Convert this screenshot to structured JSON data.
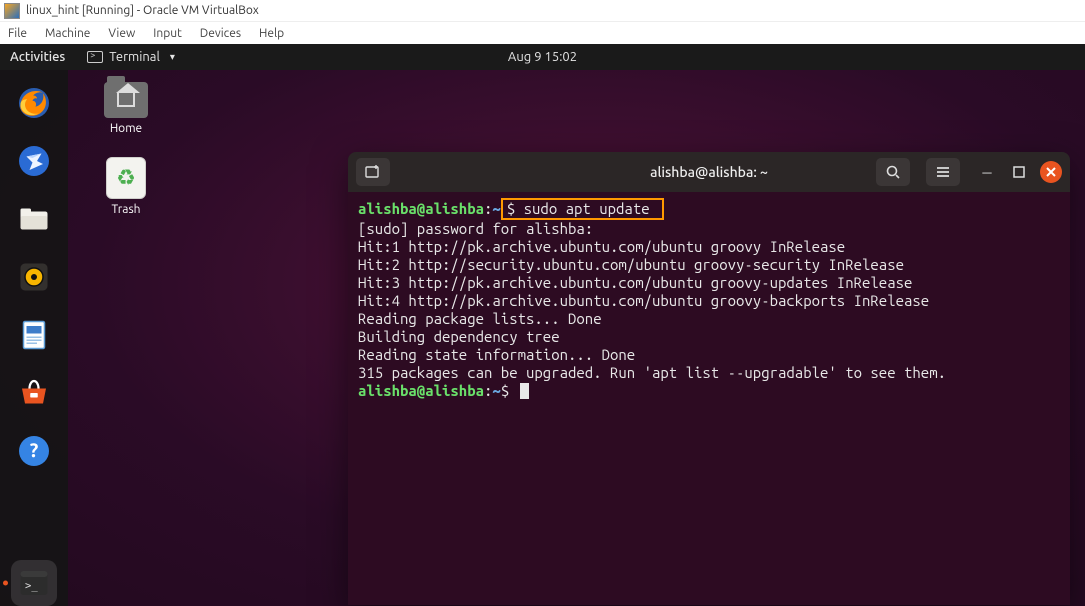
{
  "host": {
    "title": "linux_hint [Running] - Oracle VM VirtualBox",
    "menu": [
      "File",
      "Machine",
      "View",
      "Input",
      "Devices",
      "Help"
    ]
  },
  "topbar": {
    "activities": "Activities",
    "appname": "Terminal",
    "clock": "Aug 9  15:02"
  },
  "desktop_icons": {
    "home": "Home",
    "trash": "Trash"
  },
  "dock_items": [
    "firefox",
    "thunderbird",
    "files",
    "rhythmbox",
    "libreoffice",
    "software",
    "help",
    "terminal"
  ],
  "terminal": {
    "title": "alishba@alishba: ~",
    "prompt_user": "alishba@alishba",
    "prompt_sep": ":",
    "prompt_path": "~",
    "prompt_sym": "$",
    "command": " sudo apt update ",
    "lines": [
      "[sudo] password for alishba:",
      "Hit:1 http://pk.archive.ubuntu.com/ubuntu groovy InRelease",
      "Hit:2 http://security.ubuntu.com/ubuntu groovy-security InRelease",
      "Hit:3 http://pk.archive.ubuntu.com/ubuntu groovy-updates InRelease",
      "Hit:4 http://pk.archive.ubuntu.com/ubuntu groovy-backports InRelease",
      "Reading package lists... Done",
      "Building dependency tree",
      "Reading state information... Done",
      "315 packages can be upgraded. Run 'apt list --upgradable' to see them."
    ]
  }
}
